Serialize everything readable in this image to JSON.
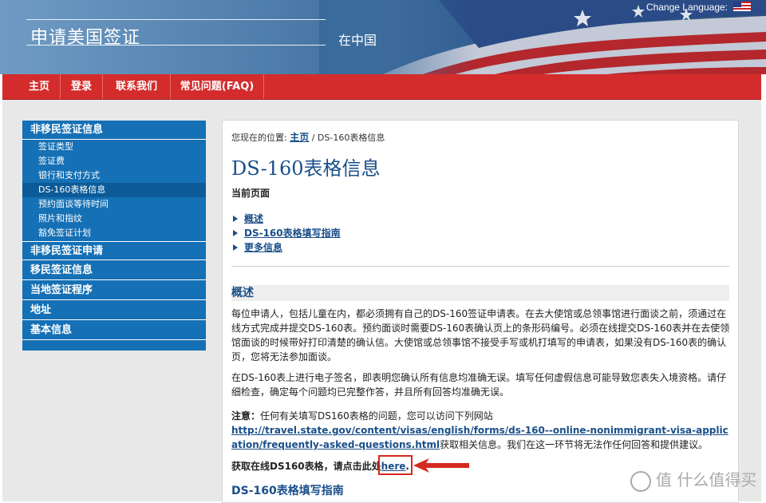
{
  "header": {
    "title": "申请美国签证",
    "subtitle": "在中国",
    "change_language": "Change Language:"
  },
  "nav": [
    "主页",
    "登录",
    "联系我们",
    "常见问题(FAQ)"
  ],
  "sidebar": {
    "sections": [
      {
        "label": "非移民签证信息",
        "items": [
          "签证类型",
          "签证费",
          "银行和支付方式",
          "DS-160表格信息",
          "预约面谈等待时间",
          "照片和指纹",
          "豁免签证计划"
        ]
      },
      {
        "label": "非移民签证申请"
      },
      {
        "label": "移民签证信息"
      },
      {
        "label": "当地签证程序"
      },
      {
        "label": "地址"
      },
      {
        "label": "基本信息"
      }
    ],
    "active_item": "DS-160表格信息"
  },
  "breadcrumb": {
    "prefix": "您现在的位置:",
    "home": "主页",
    "current": "/ DS-160表格信息"
  },
  "page_title": "DS-160表格信息",
  "current_page_label": "当前页面",
  "toc": [
    "概述",
    "DS-160表格填写指南",
    "更多信息"
  ],
  "section1": {
    "heading": "概述",
    "p1": "每位申请人，包括儿童在内，都必须拥有自己的DS-160签证申请表。在去大使馆或总领事馆进行面谈之前，须通过在线方式完成并提交DS-160表。预约面谈时需要DS-160表确认页上的条形码编号。必须在线提交DS-160表并在去使领馆面谈的时候带好打印清楚的确认信。大使馆或总领事馆不接受手写或机打填写的申请表，如果没有DS-160表的确认页，您将无法参加面谈。",
    "p2": "在DS-160表上进行电子签名，即表明您确认所有信息均准确无误。填写任何虚假信息可能导致您表失入境资格。请仔细检查，确定每个问题均已完整作答，并且所有回答均准确无误。",
    "note_label": "注意：",
    "note_text": "任何有关填写DS160表格的问题，您可以访问下列网站",
    "note_link": "http://travel.state.gov/content/visas/english/forms/ds-160--online-nonimmigrant-visa-application/frequently-asked-questions.html",
    "note_tail": "获取相关信息。我们在这一环节将无法作任何回答和提供建议。",
    "get_text": "获取在线DS160表格，请点击此处",
    "get_link": "here",
    "get_period": "."
  },
  "section2": {
    "heading": "DS-160表格填写指南"
  },
  "watermark": "值 什么值得买",
  "colors": {
    "nav_red": "#d42c2c",
    "sidebar_blue": "#1570b5",
    "link_blue": "#1a4f8a"
  }
}
